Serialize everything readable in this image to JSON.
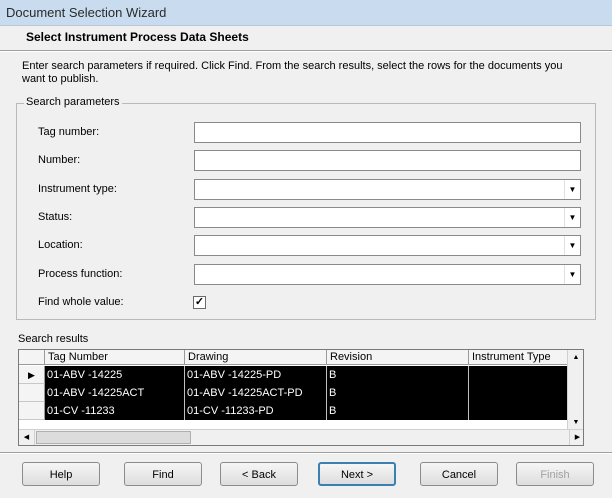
{
  "window": {
    "title": "Document Selection Wizard"
  },
  "page": {
    "heading": "Select Instrument Process Data Sheets",
    "instructions": "Enter search parameters if required. Click Find. From the search results, select the rows for the documents you want to publish."
  },
  "search": {
    "group_label": "Search parameters",
    "fields": {
      "tag_number": {
        "label": "Tag number:",
        "value": ""
      },
      "number": {
        "label": "Number:",
        "value": ""
      },
      "instrument_type": {
        "label": "Instrument type:",
        "value": ""
      },
      "status": {
        "label": "Status:",
        "value": ""
      },
      "location": {
        "label": "Location:",
        "value": ""
      },
      "process_function": {
        "label": "Process function:",
        "value": ""
      }
    },
    "find_whole_value": {
      "label": "Find whole value:",
      "checked": true,
      "mark": "✓"
    }
  },
  "results": {
    "label": "Search results",
    "columns": [
      "Tag Number",
      "Drawing",
      "Revision",
      "Instrument Type"
    ],
    "rows": [
      {
        "tag": "01-ABV -14225",
        "drawing": "01-ABV -14225-PD",
        "revision": "B",
        "type": ""
      },
      {
        "tag": "01-ABV -14225ACT",
        "drawing": "01-ABV -14225ACT-PD",
        "revision": "B",
        "type": ""
      },
      {
        "tag": "01-CV -11233",
        "drawing": "01-CV -11233-PD",
        "revision": "B",
        "type": ""
      }
    ],
    "current_row_marker": "▶"
  },
  "buttons": {
    "help": "Help",
    "find": "Find",
    "back": "< Back",
    "next": "Next >",
    "cancel": "Cancel",
    "finish": "Finish"
  },
  "icons": {
    "dropdown": "chevron-down-icon",
    "scroll_up": "arrow-up-icon",
    "scroll_down": "arrow-down-icon",
    "scroll_left": "arrow-left-icon",
    "scroll_right": "arrow-right-icon"
  }
}
